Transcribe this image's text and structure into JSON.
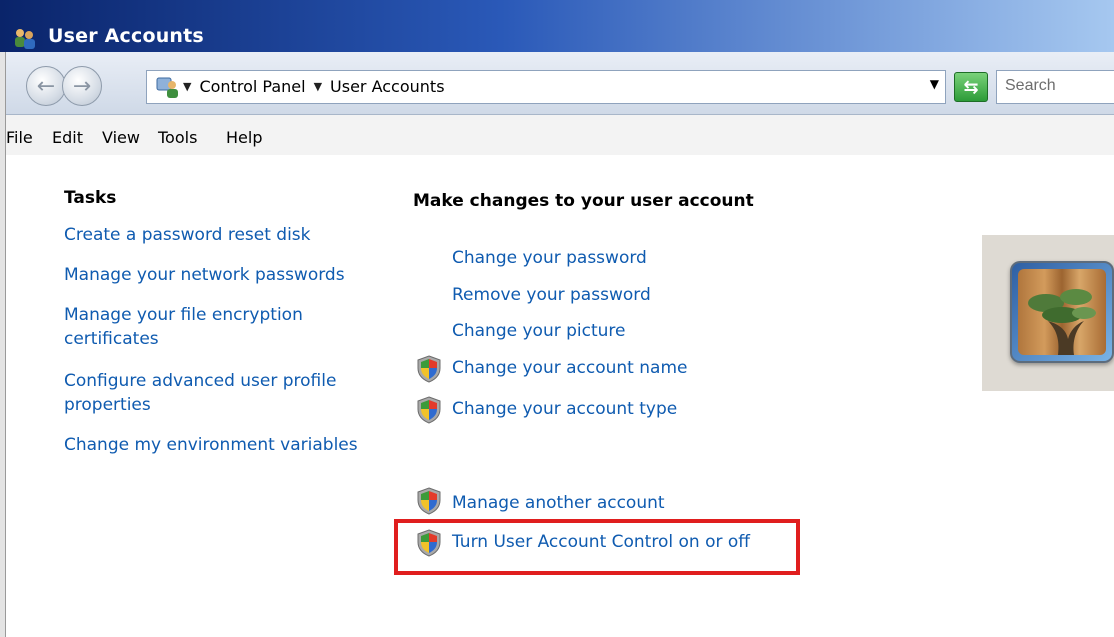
{
  "window": {
    "title": "User Accounts"
  },
  "toolbar": {
    "breadcrumb": [
      "Control Panel",
      "User Accounts"
    ],
    "search_placeholder": "Search"
  },
  "menu": [
    "File",
    "Edit",
    "View",
    "Tools",
    "Help"
  ],
  "tasks": {
    "heading": "Tasks",
    "links": [
      "Create a password reset disk",
      "Manage your network passwords",
      "Manage your file encryption certificates",
      "Configure advanced user profile properties",
      "Change my environment variables"
    ]
  },
  "main": {
    "heading": "Make changes to your user account",
    "links": [
      {
        "label": "Change your password",
        "shield": false
      },
      {
        "label": "Remove your password",
        "shield": false
      },
      {
        "label": "Change your picture",
        "shield": false
      },
      {
        "label": "Change your account name",
        "shield": true
      },
      {
        "label": "Change your account type",
        "shield": true
      },
      {
        "label": "Manage another account",
        "shield": true
      },
      {
        "label": "Turn User Account Control on or off",
        "shield": true,
        "highlighted": true
      }
    ]
  },
  "colors": {
    "link": "#0f5bb0",
    "highlight": "#e01e1e",
    "titlebar": "#0a246a"
  },
  "icons": [
    "users-icon",
    "back-arrow-icon",
    "forward-arrow-icon",
    "control-panel-icon",
    "refresh-icon",
    "uac-shield-icon"
  ]
}
